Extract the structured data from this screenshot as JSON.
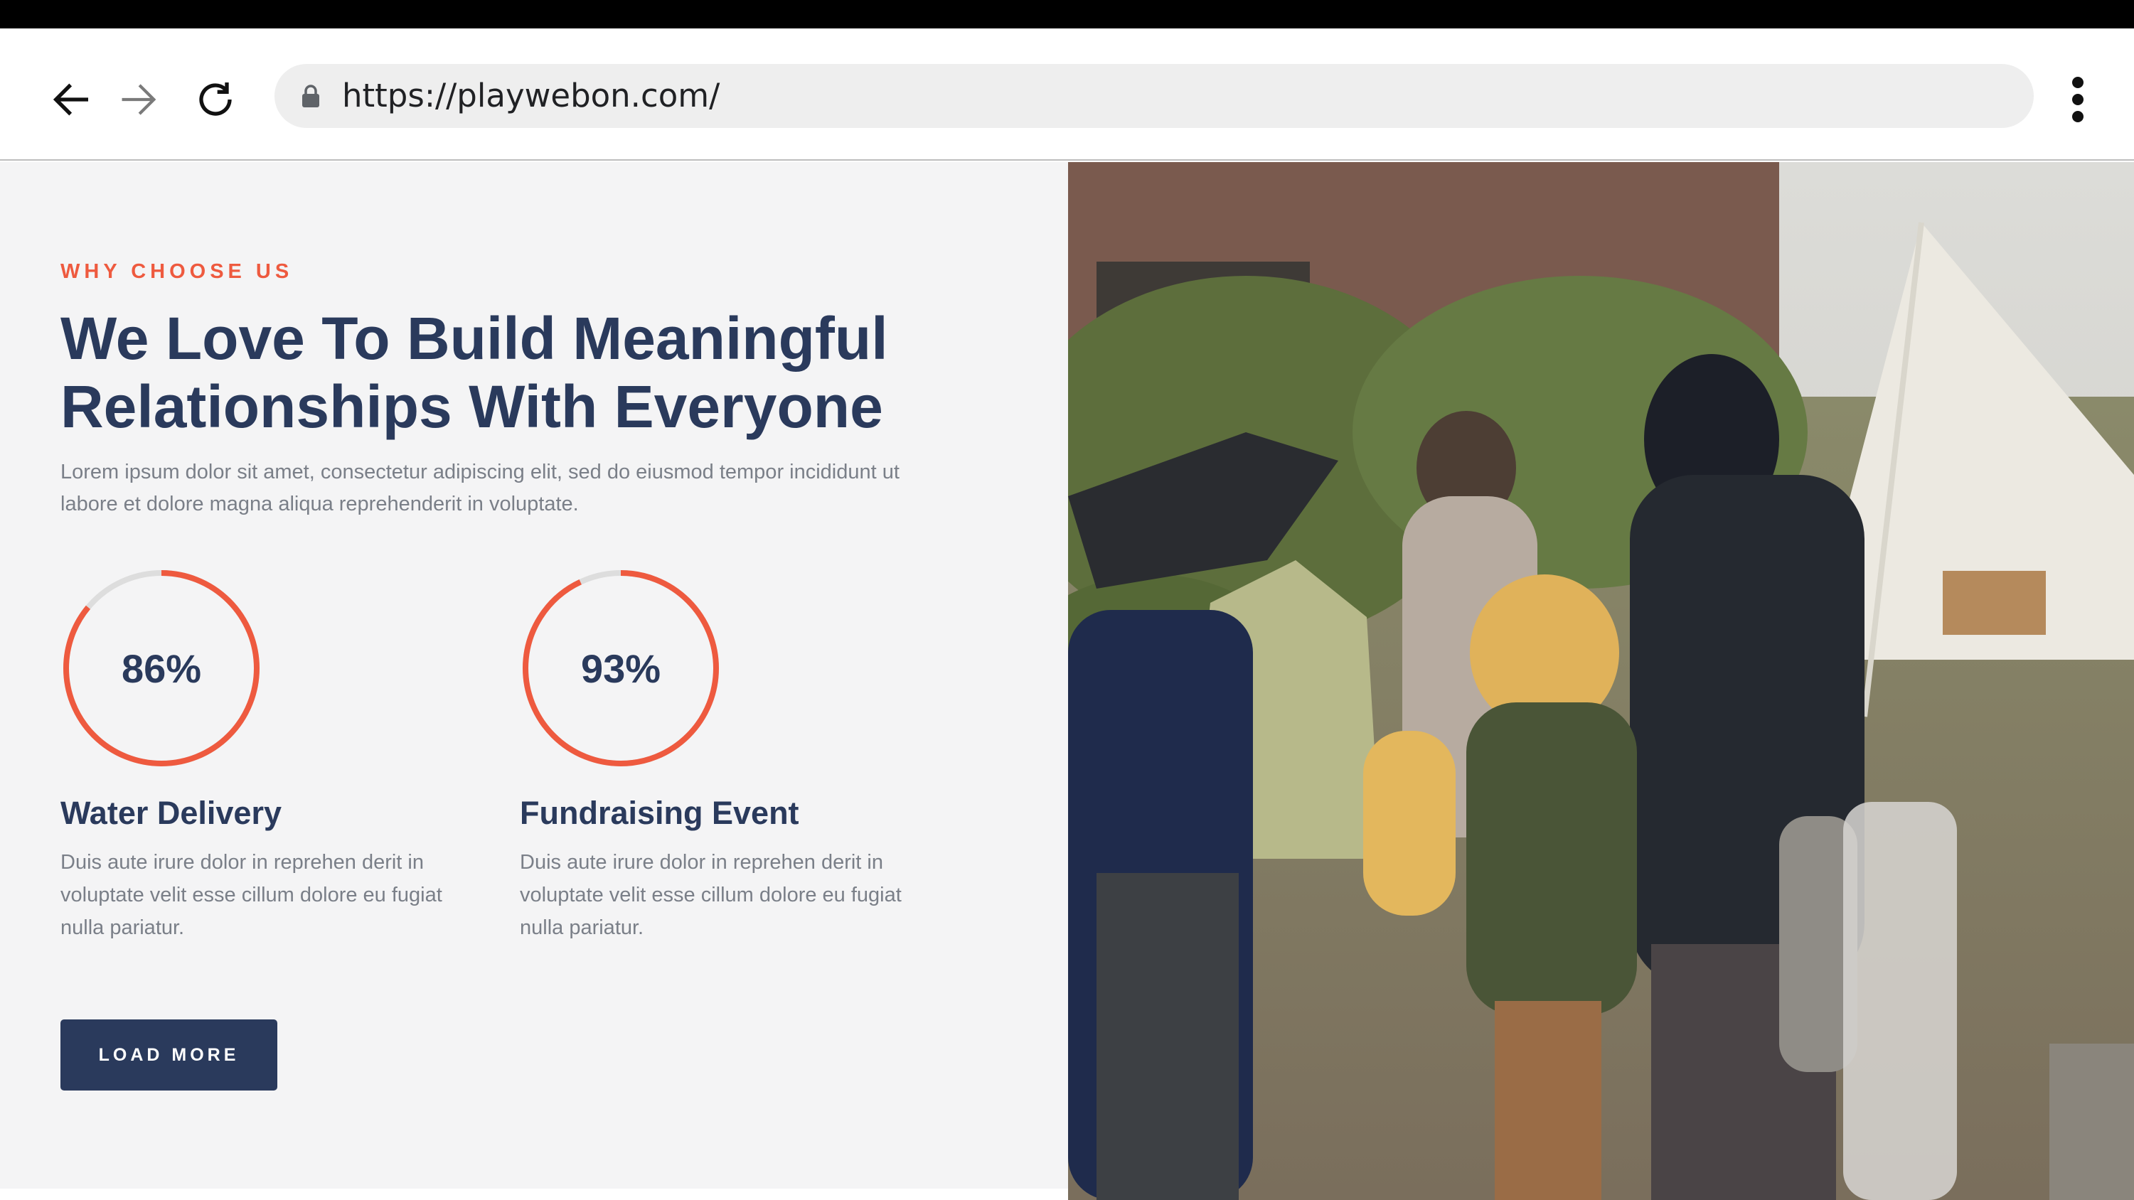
{
  "browser": {
    "url": "https://playwebon.com/",
    "icons": {
      "back": "arrow-left-icon",
      "forward": "arrow-right-icon",
      "reload": "reload-icon",
      "lock": "lock-icon",
      "menu": "more-vertical-icon"
    }
  },
  "section": {
    "eyebrow": "WHY CHOOSE US",
    "heading_line1": "We Love To Build Meaningful",
    "heading_line2": "Relationships With Everyone",
    "lede": "Lorem ipsum dolor sit amet, consectetur adipiscing elit, sed do eiusmod tempor incididunt ut labore et dolore magna aliqua reprehenderit in voluptate."
  },
  "stats": [
    {
      "value": "86%",
      "progress": 0.86,
      "title": "Water Delivery",
      "description": "Duis aute irure dolor in reprehen derit in voluptate velit esse cillum dolore eu fugiat nulla pariatur."
    },
    {
      "value": "93%",
      "progress": 0.93,
      "title": "Fundraising Event",
      "description": "Duis aute irure dolor in reprehen derit in voluptate velit esse cillum dolore eu fugiat nulla pariatur."
    }
  ],
  "cta": {
    "label": "LOAD MORE"
  },
  "colors": {
    "accent": "#ee5a3f",
    "navy": "#2a3a5c",
    "ring_track": "#dddddd",
    "panel_bg": "#f4f4f5"
  }
}
